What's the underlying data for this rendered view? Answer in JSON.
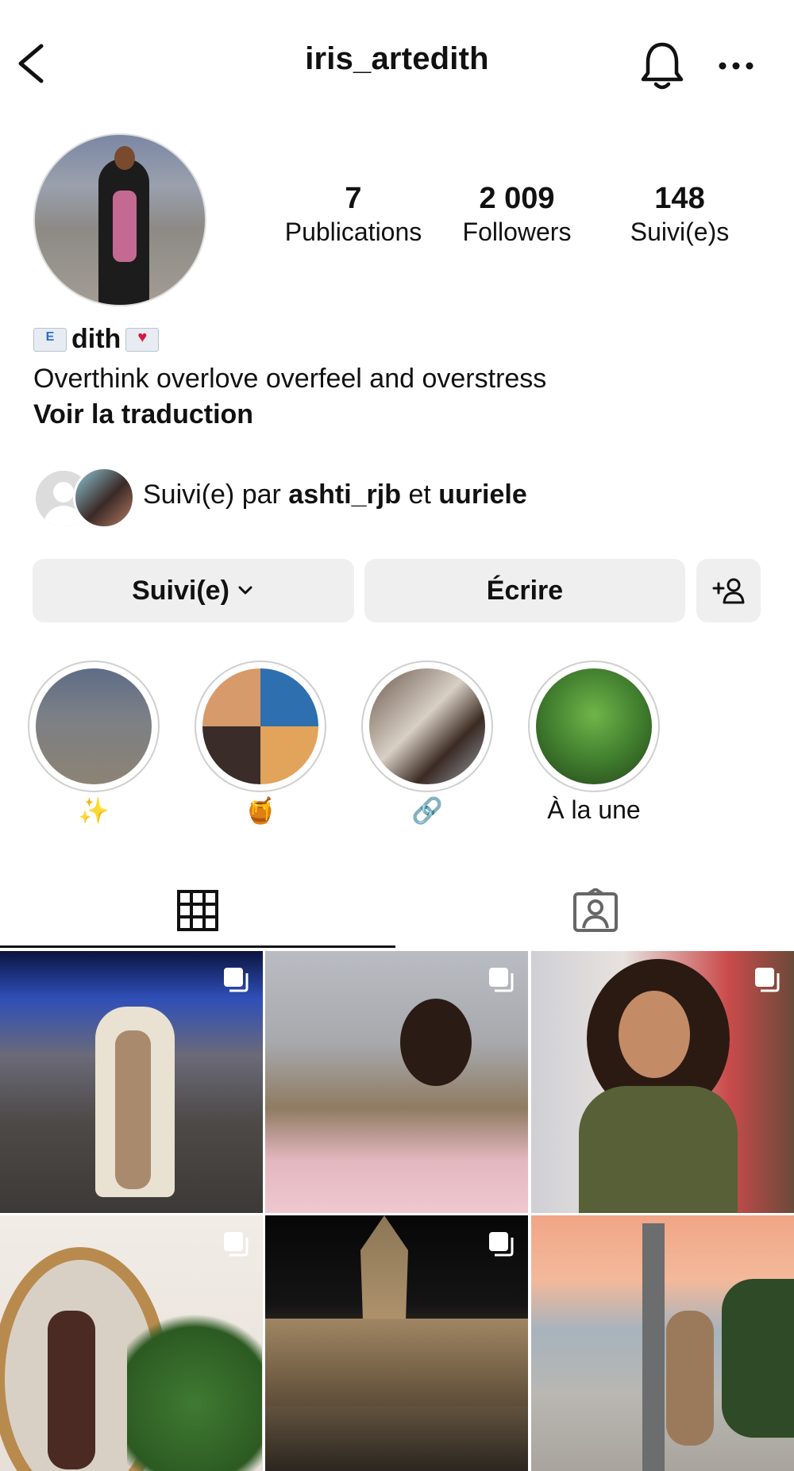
{
  "header": {
    "username": "iris_artedith"
  },
  "stats": [
    {
      "value": "7",
      "label": "Publications"
    },
    {
      "value": "2 009",
      "label": "Followers"
    },
    {
      "value": "148",
      "label": "Suivi(e)s"
    }
  ],
  "bio": {
    "name": "dith",
    "text": "Overthink overlove overfeel and overstress",
    "translate": "Voir la traduction"
  },
  "followed_by": {
    "prefix": "Suivi(e) par",
    "user1": "ashti_rjb",
    "joiner": "et",
    "user2": "uuriele"
  },
  "buttons": {
    "follow": "Suivi(e)",
    "message": "Écrire"
  },
  "highlights": [
    {
      "label": "✨"
    },
    {
      "label": "🍯"
    },
    {
      "label": "🔗"
    },
    {
      "label": "À la une"
    }
  ],
  "colors": {
    "button_bg": "#efefef",
    "text": "#111111",
    "divider": "#111111"
  }
}
